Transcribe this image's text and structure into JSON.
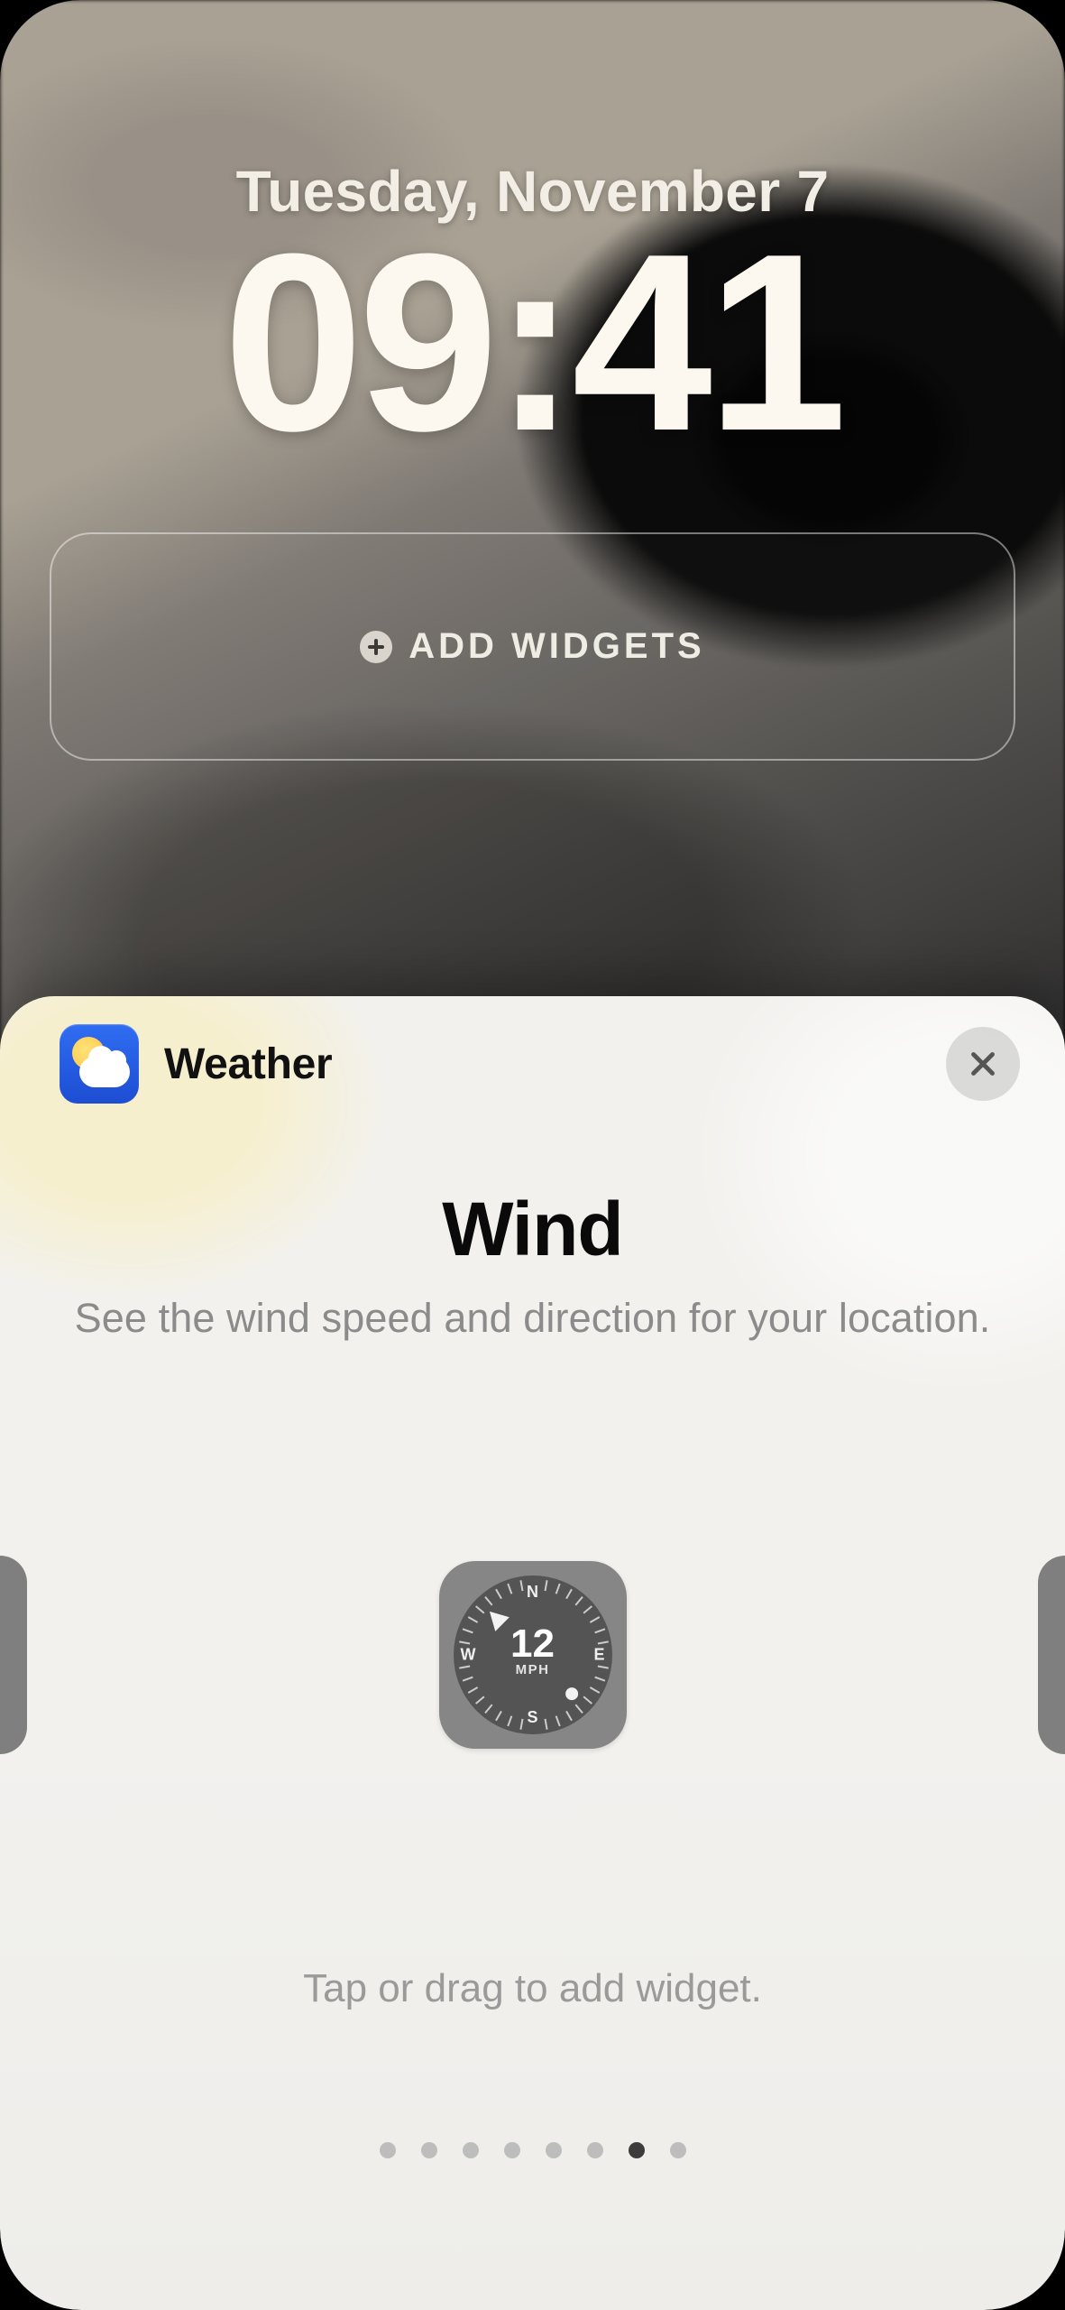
{
  "lockscreen": {
    "date": "Tuesday, November 7",
    "time": "09:41",
    "add_widgets_label": "ADD WIDGETS"
  },
  "sheet": {
    "app_name": "Weather",
    "heading": "Wind",
    "subheading": "See the wind speed and direction for your location.",
    "hint": "Tap or drag to add widget."
  },
  "wind_widget": {
    "value": "12",
    "unit": "MPH",
    "cardinals": {
      "n": "N",
      "s": "S",
      "e": "E",
      "w": "W"
    },
    "direction_deg": 135
  },
  "pagination": {
    "count": 8,
    "active_index": 6
  }
}
